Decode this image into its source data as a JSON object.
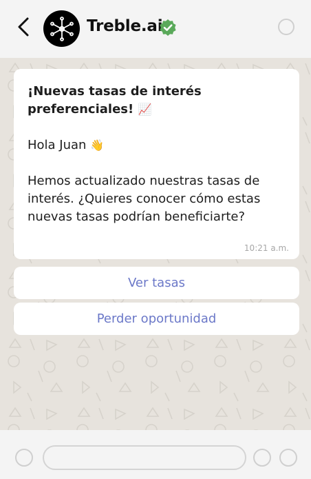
{
  "header": {
    "title": "Treble.ai",
    "back_icon": "chevron-left-icon",
    "avatar_icon": "network-node-icon",
    "verified_icon": "verified-check-icon",
    "verified_color": "#5aa95a"
  },
  "message": {
    "headline": "¡Nuevas tasas de interés preferenciales!",
    "headline_emoji": "📈",
    "greeting": "Hola Juan",
    "greeting_emoji": "👋",
    "body": "Hemos actualizado nuestras tasas de interés. ¿Quieres conocer cómo estas nuevas tasas podrían beneficiarte?",
    "time": "10:21 a.m."
  },
  "quick_replies": [
    {
      "label": "Ver tasas"
    },
    {
      "label": "Perder oportunidad"
    }
  ],
  "colors": {
    "chat_background": "#e7e3dd",
    "bar_background": "#f4f4f4",
    "button_text": "#6b78c8"
  }
}
